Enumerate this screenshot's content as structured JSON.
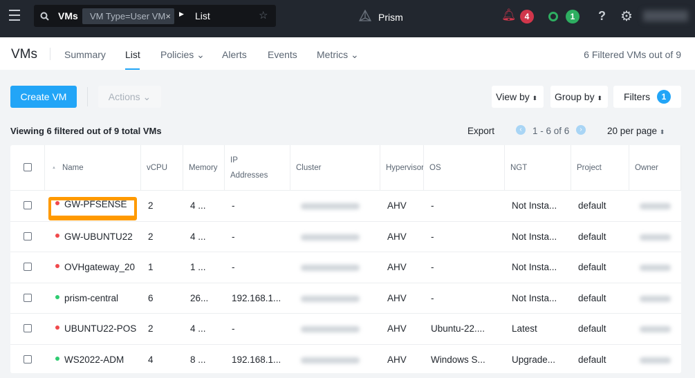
{
  "topbar": {
    "search_entity": "VMs",
    "filter_chip": "VM Type=User VM",
    "breadcrumb": "List",
    "app_name": "Prism",
    "alerts_count": "4",
    "tasks_count": "1",
    "accent_alert": "#d1364b",
    "accent_task": "#2eae61"
  },
  "nav": {
    "title": "VMs",
    "tabs": [
      {
        "label": "Summary"
      },
      {
        "label": "List",
        "active": true
      },
      {
        "label": "Policies ⌄"
      },
      {
        "label": "Alerts"
      },
      {
        "label": "Events"
      },
      {
        "label": "Metrics ⌄"
      }
    ],
    "summary": "6 Filtered VMs out of 9"
  },
  "toolbar": {
    "create": "Create VM",
    "actions": "Actions ⌄",
    "view_by": "View by",
    "group_by": "Group by",
    "filters": "Filters",
    "filters_count": "1",
    "accent": "#22a5f7"
  },
  "listbar": {
    "viewing": "Viewing 6 filtered out of 9 total VMs",
    "export": "Export",
    "pagination": "1 - 6 of 6",
    "per_page": "20 per page"
  },
  "table": {
    "columns": [
      "Name",
      "vCPU",
      "Memory",
      "IP\nAddresses",
      "Cluster",
      "Hypervisor",
      "OS",
      "NGT",
      "Project",
      "Owner"
    ],
    "rows": [
      {
        "name": "GW-PFSENSE",
        "status": "off",
        "vcpu": "2",
        "memory": "4 ...",
        "ip": "-",
        "hypervisor": "AHV",
        "os": "-",
        "ngt": "Not Insta...",
        "project": "default",
        "highlighted": true
      },
      {
        "name": "GW-UBUNTU22",
        "status": "off",
        "vcpu": "2",
        "memory": "4 ...",
        "ip": "-",
        "hypervisor": "AHV",
        "os": "-",
        "ngt": "Not Insta...",
        "project": "default"
      },
      {
        "name": "OVHgateway_20",
        "status": "off",
        "vcpu": "1",
        "memory": "1 ...",
        "ip": "-",
        "hypervisor": "AHV",
        "os": "-",
        "ngt": "Not Insta...",
        "project": "default"
      },
      {
        "name": "prism-central",
        "status": "on",
        "vcpu": "6",
        "memory": "26...",
        "ip": "192.168.1...",
        "hypervisor": "AHV",
        "os": "-",
        "ngt": "Not Insta...",
        "project": "default"
      },
      {
        "name": "UBUNTU22-POS",
        "status": "off",
        "vcpu": "2",
        "memory": "4 ...",
        "ip": "-",
        "hypervisor": "AHV",
        "os": "Ubuntu-22....",
        "ngt": "Latest",
        "project": "default"
      },
      {
        "name": "WS2022-ADM",
        "status": "on",
        "vcpu": "4",
        "memory": "8 ...",
        "ip": "192.168.1...",
        "hypervisor": "AHV",
        "os": "Windows S...",
        "ngt": "Upgrade...",
        "project": "default"
      }
    ]
  }
}
